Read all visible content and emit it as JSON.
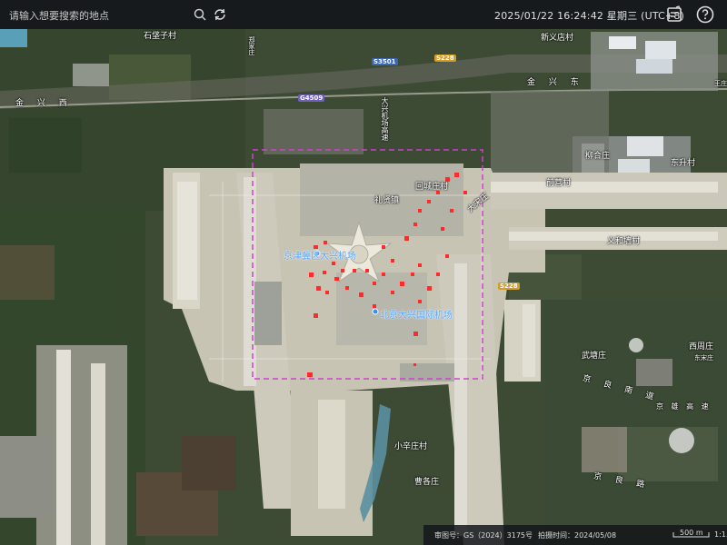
{
  "search": {
    "placeholder": "请输入想要搜索的地点",
    "value": ""
  },
  "header": {
    "datetime": "2025/01/22 16:24:42 星期三 (UTC+8)"
  },
  "map": {
    "place_labels": [
      {
        "id": "shixiaozhuang",
        "text": "石垡子村"
      },
      {
        "id": "xinyidian",
        "text": "新义店村"
      },
      {
        "id": "yingbiao",
        "text": "郑家庄"
      },
      {
        "id": "libingzhuang",
        "text": "礼贤镇"
      },
      {
        "id": "tonghe",
        "text": "柳合庄"
      },
      {
        "id": "baozhuang",
        "text": "前营村"
      },
      {
        "id": "dongqiaocun",
        "text": "东升村"
      },
      {
        "id": "mudun",
        "text": "回城庄村"
      },
      {
        "id": "dasongzhuang",
        "text": "大宋庄"
      },
      {
        "id": "yishan",
        "text": "义和墙村"
      },
      {
        "id": "wutongzhuang",
        "text": "武塘庄"
      },
      {
        "id": "yuanzhuang",
        "text": "西周庄"
      },
      {
        "id": "baoluo",
        "text": "王庄"
      },
      {
        "id": "xiaoxinzhuang",
        "text": "东宋庄"
      },
      {
        "id": "xiaonanzhuang",
        "text": "小辛庄村"
      },
      {
        "id": "caozhuang",
        "text": "曹各庄"
      }
    ],
    "poi_labels": [
      {
        "id": "airport_entity",
        "text": "京津冀区大兴机场"
      },
      {
        "id": "airport_main",
        "text": "北京大兴国际机场"
      }
    ],
    "road_labels": [
      {
        "id": "road_left",
        "text": "金 兴 西"
      },
      {
        "id": "road_right",
        "text": "金 兴 东"
      },
      {
        "id": "road_se",
        "text": "京 良 南 道"
      },
      {
        "id": "road_e",
        "text": "京 雄 高 速"
      },
      {
        "id": "road_v",
        "text": "大兴机场高速"
      },
      {
        "id": "road_bottom",
        "text": "京 良 路"
      }
    ],
    "shields": [
      {
        "id": "s3501",
        "text": "S3501",
        "color": "blue"
      },
      {
        "id": "s228a",
        "text": "S228",
        "color": "yellow"
      },
      {
        "id": "s228b",
        "text": "S228",
        "color": "yellow"
      },
      {
        "id": "g4509",
        "text": "G4509",
        "color": "purple"
      }
    ],
    "selection_color": "#d040d0",
    "marker_color": "#ff2a2a"
  },
  "footer": {
    "approval": "审图号：GS（2024）3175号",
    "capture": "拍摄时间：2024/05/08",
    "scale": "500 m",
    "zoom": "1:1.6"
  }
}
